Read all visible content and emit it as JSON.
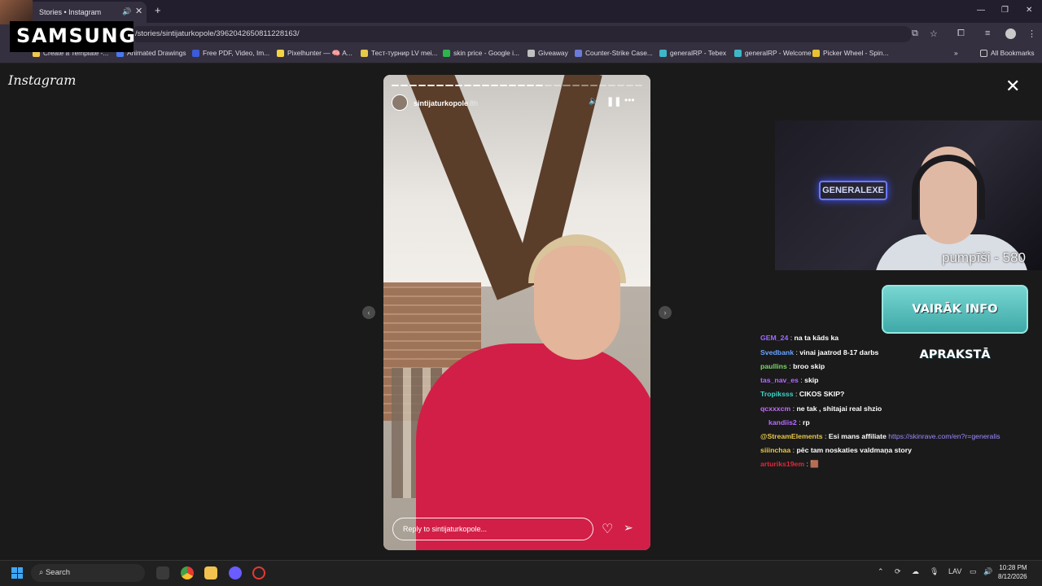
{
  "browser": {
    "tab_title": "Stories • Instagram",
    "url": "/stories/sintijaturkopole/3962042650811228163/",
    "bookmarks": [
      {
        "label": "Create a Template -...",
        "color": "#f0c94a"
      },
      {
        "label": "Animated Drawings",
        "color": "#4a78f0"
      },
      {
        "label": "Free PDF, Video, Im...",
        "color": "#3b5bdb"
      },
      {
        "label": "Pixelhunter — 🧠 A...",
        "color": "#f5d442"
      },
      {
        "label": "Тест-турнир LV mei...",
        "color": "#e6c84a"
      },
      {
        "label": "skin price - Google i...",
        "color": "#2fb34f"
      },
      {
        "label": "Giveaway",
        "color": "#bfbfbf"
      },
      {
        "label": "Counter-Strike Case...",
        "color": "#6a7bd8"
      },
      {
        "label": "generalRP - Tebex",
        "color": "#3fb6c8"
      },
      {
        "label": "generalRP - Welcome",
        "color": "#3fb6c8"
      },
      {
        "label": "Picker Wheel - Spin...",
        "color": "#e9c234"
      }
    ],
    "all_bookmarks": "All Bookmarks"
  },
  "overlay": {
    "brand": "SAMSUNG",
    "counter": "pumpīši - 580",
    "neon_sign": "GENERALEXE",
    "info_banner": "VAIRĀK INFO APRAKSTĀ"
  },
  "instagram": {
    "logo": "Instagram",
    "story": {
      "username": "sintijaturkopole",
      "time": "8h",
      "reply_placeholder": "Reply to sintijaturkopole...",
      "segments_total": 28,
      "segments_done": 17
    }
  },
  "chat": [
    {
      "user": "GEM_24",
      "msg": "na ta kāds ka",
      "color": "#9b6bff"
    },
    {
      "user": "Svedbank",
      "msg": "vinai jaatrod 8-17 darbs",
      "color": "#6aa3ff"
    },
    {
      "user": "paullins",
      "msg": "broo skip",
      "color": "#7bd66a"
    },
    {
      "user": "tas_nav_es",
      "msg": "skip",
      "color": "#b26bff"
    },
    {
      "user": "Tropiksss",
      "msg": "CIKOS SKIP?",
      "color": "#3ad6c8"
    },
    {
      "user": "qcxxxcm",
      "msg": "ne tak , shitajai real shzio",
      "color": "#c46bff"
    },
    {
      "user": "kandiis2",
      "msg": "rp",
      "color": "#b66bff"
    },
    {
      "user": "@StreamElements",
      "msg": "Esi mans affiliate",
      "link": "https://skinrave.com/en?r=generalis",
      "color": "#e8c84a"
    },
    {
      "user": "siiinchaa",
      "msg": "pēc tam noskaties valdmaņa story",
      "color": "#e6c84a"
    },
    {
      "user": "arturiks19em",
      "msg": "🟫",
      "color": "#e0283c"
    }
  ],
  "taskbar": {
    "search_placeholder": "Search",
    "language": "LAV",
    "time": "10:28 PM",
    "date": "8/12/2026"
  }
}
